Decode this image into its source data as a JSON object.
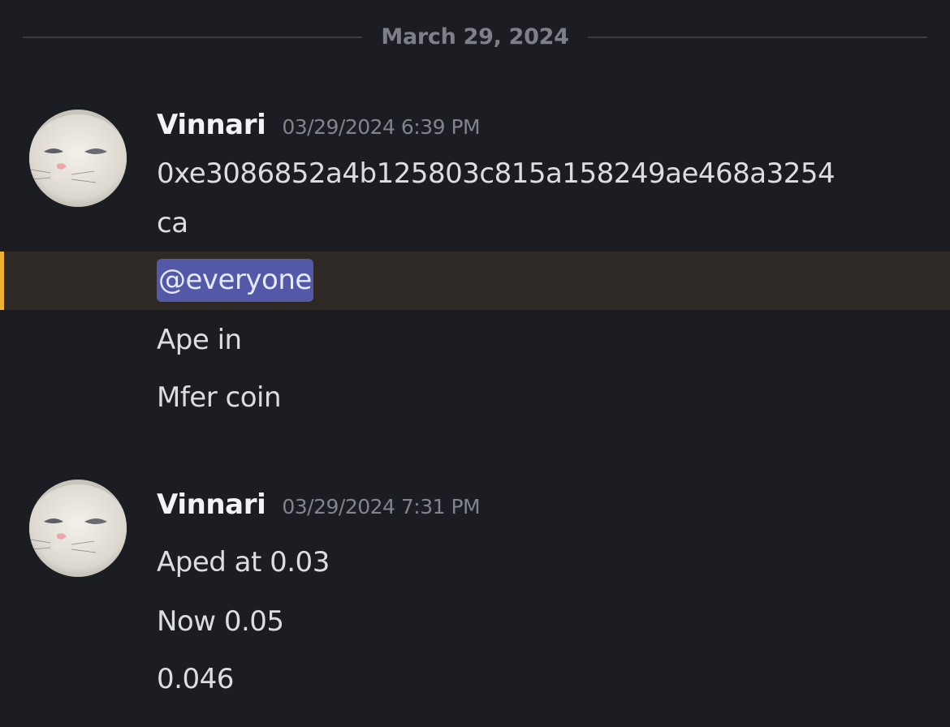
{
  "date_divider": {
    "label": "March 29, 2024"
  },
  "messages": [
    {
      "author": "Vinnari",
      "timestamp": "03/29/2024 6:39 PM",
      "lines": [
        "0xe3086852a4b125803c815a158249ae468a3254",
        "ca"
      ],
      "mention": "@everyone",
      "after_lines": [
        "Ape in",
        "Mfer coin"
      ]
    },
    {
      "author": "Vinnari",
      "timestamp": "03/29/2024 7:31 PM",
      "lines": [
        "Aped at 0.03",
        "Now 0.05",
        "0.046"
      ]
    }
  ],
  "colors": {
    "background": "#1c1d22",
    "mention_highlight_bg": "#2e2924",
    "mention_bar": "#f0b132",
    "mention_pill": "#5359a7"
  },
  "icons": {
    "avatar": "white-cat-avatar"
  }
}
